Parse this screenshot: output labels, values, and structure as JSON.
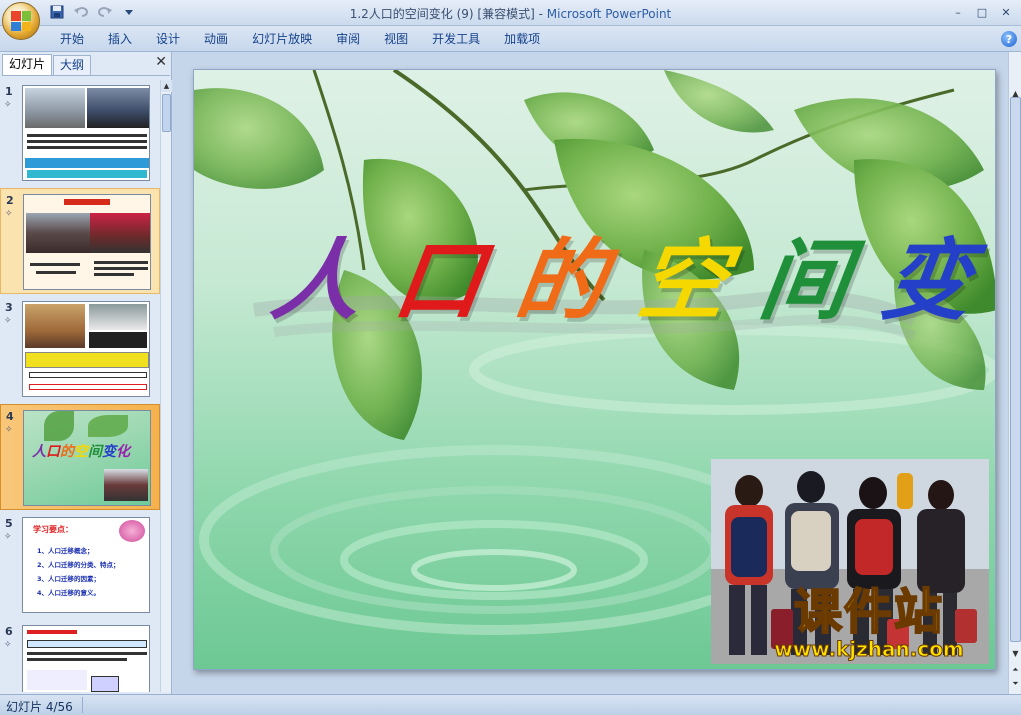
{
  "window": {
    "title_doc": "1.2人口的空间变化 (9) [兼容模式]",
    "title_sep": " - ",
    "title_app": "Microsoft PowerPoint",
    "controls": [
      "–",
      "□",
      "✕"
    ]
  },
  "quick_access": {
    "save_icon": "save-icon",
    "undo_icon": "undo-icon",
    "redo_icon": "redo-icon",
    "customize_icon": "customize-icon"
  },
  "ribbon": {
    "tabs": [
      {
        "label": "开始"
      },
      {
        "label": "插入"
      },
      {
        "label": "设计"
      },
      {
        "label": "动画"
      },
      {
        "label": "幻灯片放映"
      },
      {
        "label": "审阅"
      },
      {
        "label": "视图"
      },
      {
        "label": "开发工具"
      },
      {
        "label": "加载项"
      }
    ],
    "help": "?"
  },
  "left_pane": {
    "tabs": [
      {
        "label": "幻灯片"
      },
      {
        "label": "大纲"
      }
    ],
    "close": "✕",
    "thumbnails": [
      {
        "num": "1"
      },
      {
        "num": "2"
      },
      {
        "num": "3"
      },
      {
        "num": "4"
      },
      {
        "num": "5"
      },
      {
        "num": "6"
      }
    ]
  },
  "slide": {
    "title_chars": [
      "人",
      "口",
      "的",
      "空",
      "间",
      "变",
      "化"
    ],
    "title_colors": [
      "#7a2fa8",
      "#e01a1a",
      "#ef6b17",
      "#f4d800",
      "#1f8f3a",
      "#2540c8",
      "#9a1fb0"
    ]
  },
  "thumb5": {
    "heading": "学习要点：",
    "items": [
      "1、人口迁移概念；",
      "2、人口迁移的分类、特点；",
      "3、人口迁移的因素；",
      "4、人口迁移的意义。"
    ]
  },
  "watermark": {
    "main": "课件站",
    "url": "www.kjzhan.com"
  },
  "statusbar": {
    "text": "幻灯片 4/56"
  }
}
